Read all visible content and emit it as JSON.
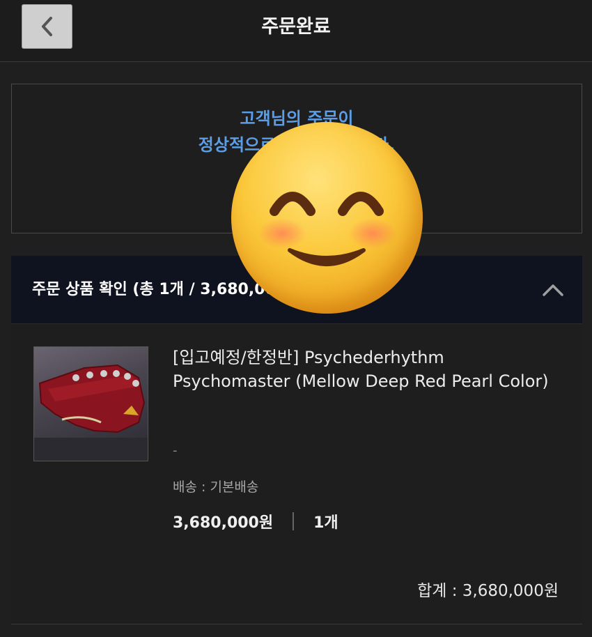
{
  "header": {
    "title": "주문완료",
    "back_icon": "chevron-left-icon"
  },
  "completion": {
    "message_line1": "고객님의 주문이",
    "message_line2": "정상적으로 완료되었습니다.",
    "order_number": "(주문번호 : )",
    "accent_color": "#5b9ee8"
  },
  "overlay": {
    "emoji": "smiling-face-with-smiling-eyes"
  },
  "order_section": {
    "title": "주문 상품 확인 (총 1개 / 3,680,000원)",
    "toggle_icon": "chevron-up-icon"
  },
  "product": {
    "name": "[입고예정/한정반] Psychederhythm Psychomaster (Mellow Deep Red Pearl Color)",
    "option": "-",
    "shipping": "배송 : 기본배송",
    "price": "3,680,000원",
    "quantity": "1개",
    "image": "guitar-headstock-image"
  },
  "summary": {
    "total": "합계 : 3,680,000원"
  }
}
